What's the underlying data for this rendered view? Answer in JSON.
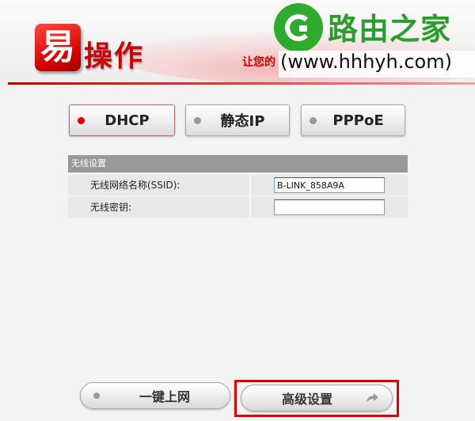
{
  "header": {
    "logo_char": "易",
    "logo_text": "操作",
    "slogan": "让您的"
  },
  "watermark": {
    "title": "路由之家",
    "url": "(www.hhhyh.com)",
    "badge_color": "#2eaa2e"
  },
  "modes": {
    "selected": "DHCP",
    "items": [
      {
        "label": "DHCP",
        "active": true
      },
      {
        "label": "静态IP",
        "active": false
      },
      {
        "label": "PPPoE",
        "active": false
      }
    ]
  },
  "wireless": {
    "section_title": "无线设置",
    "ssid_label": "无线网络名称(SSID):",
    "ssid_value": "B-LINK_858A9A",
    "key_label": "无线密钥:",
    "key_value": ""
  },
  "actions": {
    "quick_label": "一键上网",
    "advanced_label": "高级设置",
    "arrow_icon": "arrow-right-icon"
  },
  "colors": {
    "accent": "#d20000",
    "active_dot": "#e00000",
    "inactive_dot": "#999999",
    "highlight": "#e00000",
    "section_head": "#999999"
  }
}
